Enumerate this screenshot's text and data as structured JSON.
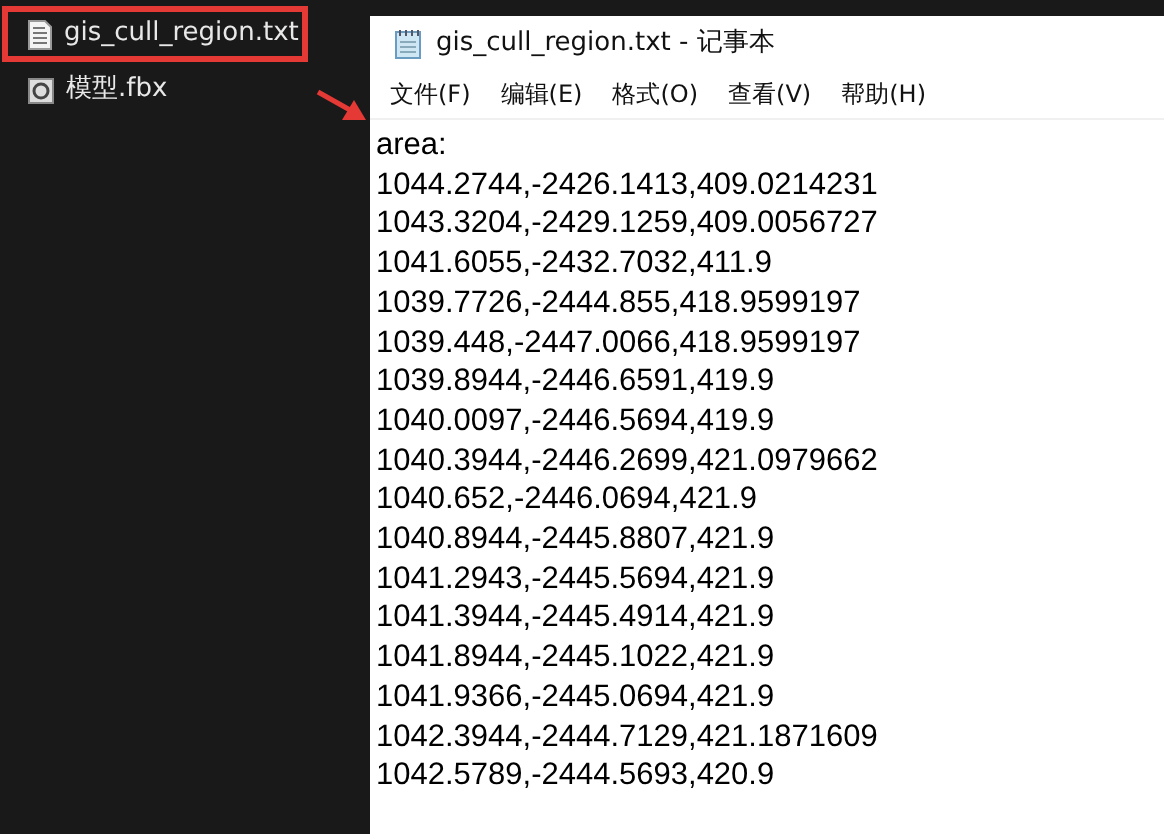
{
  "explorer": {
    "files": [
      {
        "name": "gis_cull_region.txt",
        "kind": "text",
        "highlighted": true
      },
      {
        "name": "模型.fbx",
        "kind": "model",
        "highlighted": false
      }
    ]
  },
  "window": {
    "title": "gis_cull_region.txt - 记事本"
  },
  "menu": [
    "文件(F)",
    "编辑(E)",
    "格式(O)",
    "查看(V)",
    "帮助(H)"
  ],
  "document": {
    "lines": [
      "area:",
      "1044.2744,-2426.1413,409.0214231",
      "1043.3204,-2429.1259,409.0056727",
      "1041.6055,-2432.7032,411.9",
      "1039.7726,-2444.855,418.9599197",
      "1039.448,-2447.0066,418.9599197",
      "1039.8944,-2446.6591,419.9",
      "1040.0097,-2446.5694,419.9",
      "1040.3944,-2446.2699,421.0979662",
      "1040.652,-2446.0694,421.9",
      "1040.8944,-2445.8807,421.9",
      "1041.2943,-2445.5694,421.9",
      "1041.3944,-2445.4914,421.9",
      "1041.8944,-2445.1022,421.9",
      "1041.9366,-2445.0694,421.9",
      "1042.3944,-2444.7129,421.1871609",
      "1042.5789,-2444.5693,420.9"
    ]
  }
}
